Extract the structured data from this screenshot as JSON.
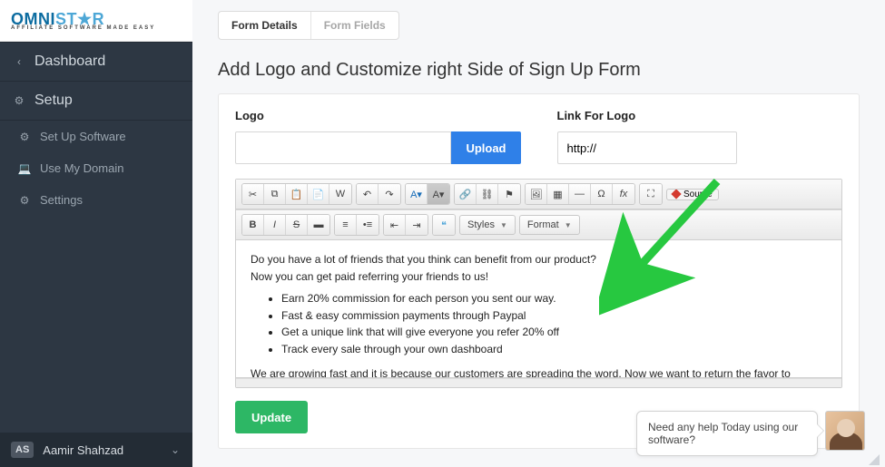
{
  "brand": {
    "name_a": "OMNI",
    "name_b": "ST",
    "name_c": "R",
    "sub": "AFFILIATE SOFTWARE MADE EASY"
  },
  "sidebar": {
    "dashboard": "Dashboard",
    "setup": "Setup",
    "items": [
      {
        "label": "Set Up Software"
      },
      {
        "label": "Use My Domain"
      },
      {
        "label": "Settings"
      }
    ]
  },
  "user": {
    "initials": "AS",
    "name": "Aamir Shahzad"
  },
  "tabs": {
    "details": "Form Details",
    "fields": "Form Fields"
  },
  "page": {
    "title": "Add Logo and Customize right Side of Sign Up Form"
  },
  "form": {
    "logo_label": "Logo",
    "link_label": "Link For Logo",
    "upload": "Upload",
    "link_value": "http://",
    "update": "Update"
  },
  "editor": {
    "styles": "Styles",
    "format": "Format",
    "source": "Source",
    "p1": "Do you have a lot of friends that you think can benefit from our product?",
    "p2": "Now you can get paid referring your friends to us!",
    "b1": "Earn 20% commission for each person you sent our way.",
    "b2": "Fast & easy commission payments through Paypal",
    "b3": "Get a unique link that will give everyone you refer 20% off",
    "b4": "Track every sale through your own dashboard",
    "p3": "We are growing fast and it is because our customers are spreading the word. Now we want to return the favor to everyone that has helped us. Start getting paid today!"
  },
  "chat": {
    "text": "Need any help Today using our software?"
  }
}
